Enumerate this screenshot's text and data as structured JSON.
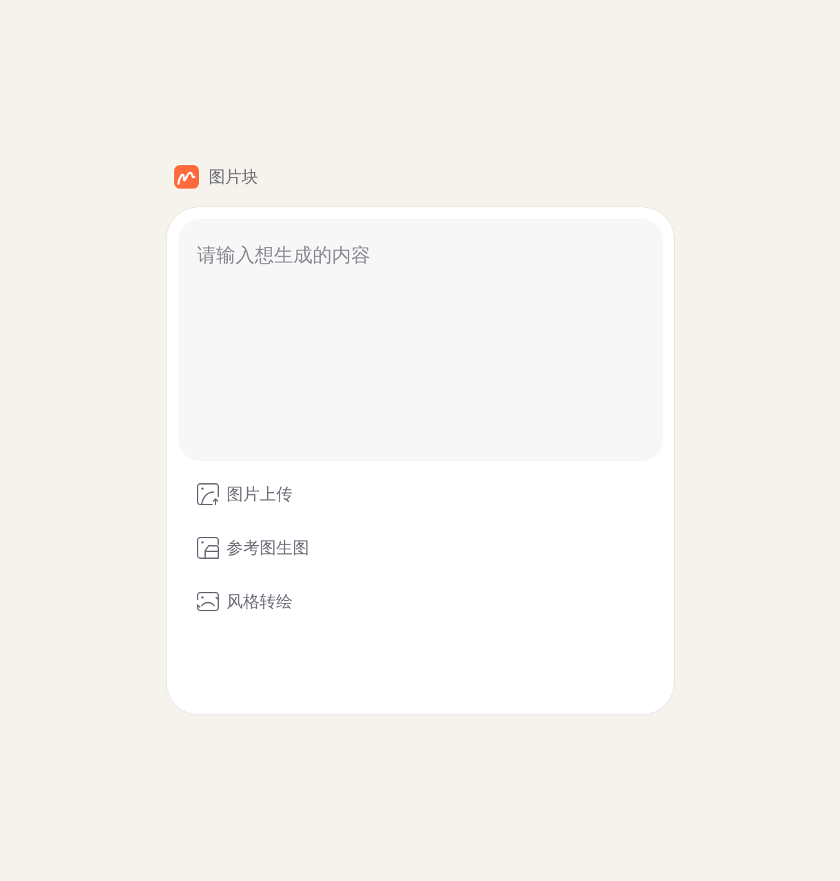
{
  "header": {
    "title": "图片块"
  },
  "prompt": {
    "placeholder": "请输入想生成的内容"
  },
  "options": [
    {
      "kind": "upload",
      "label": "图片上传"
    },
    {
      "kind": "reference",
      "label": "参考图生图"
    },
    {
      "kind": "style",
      "label": "风格转绘"
    }
  ]
}
